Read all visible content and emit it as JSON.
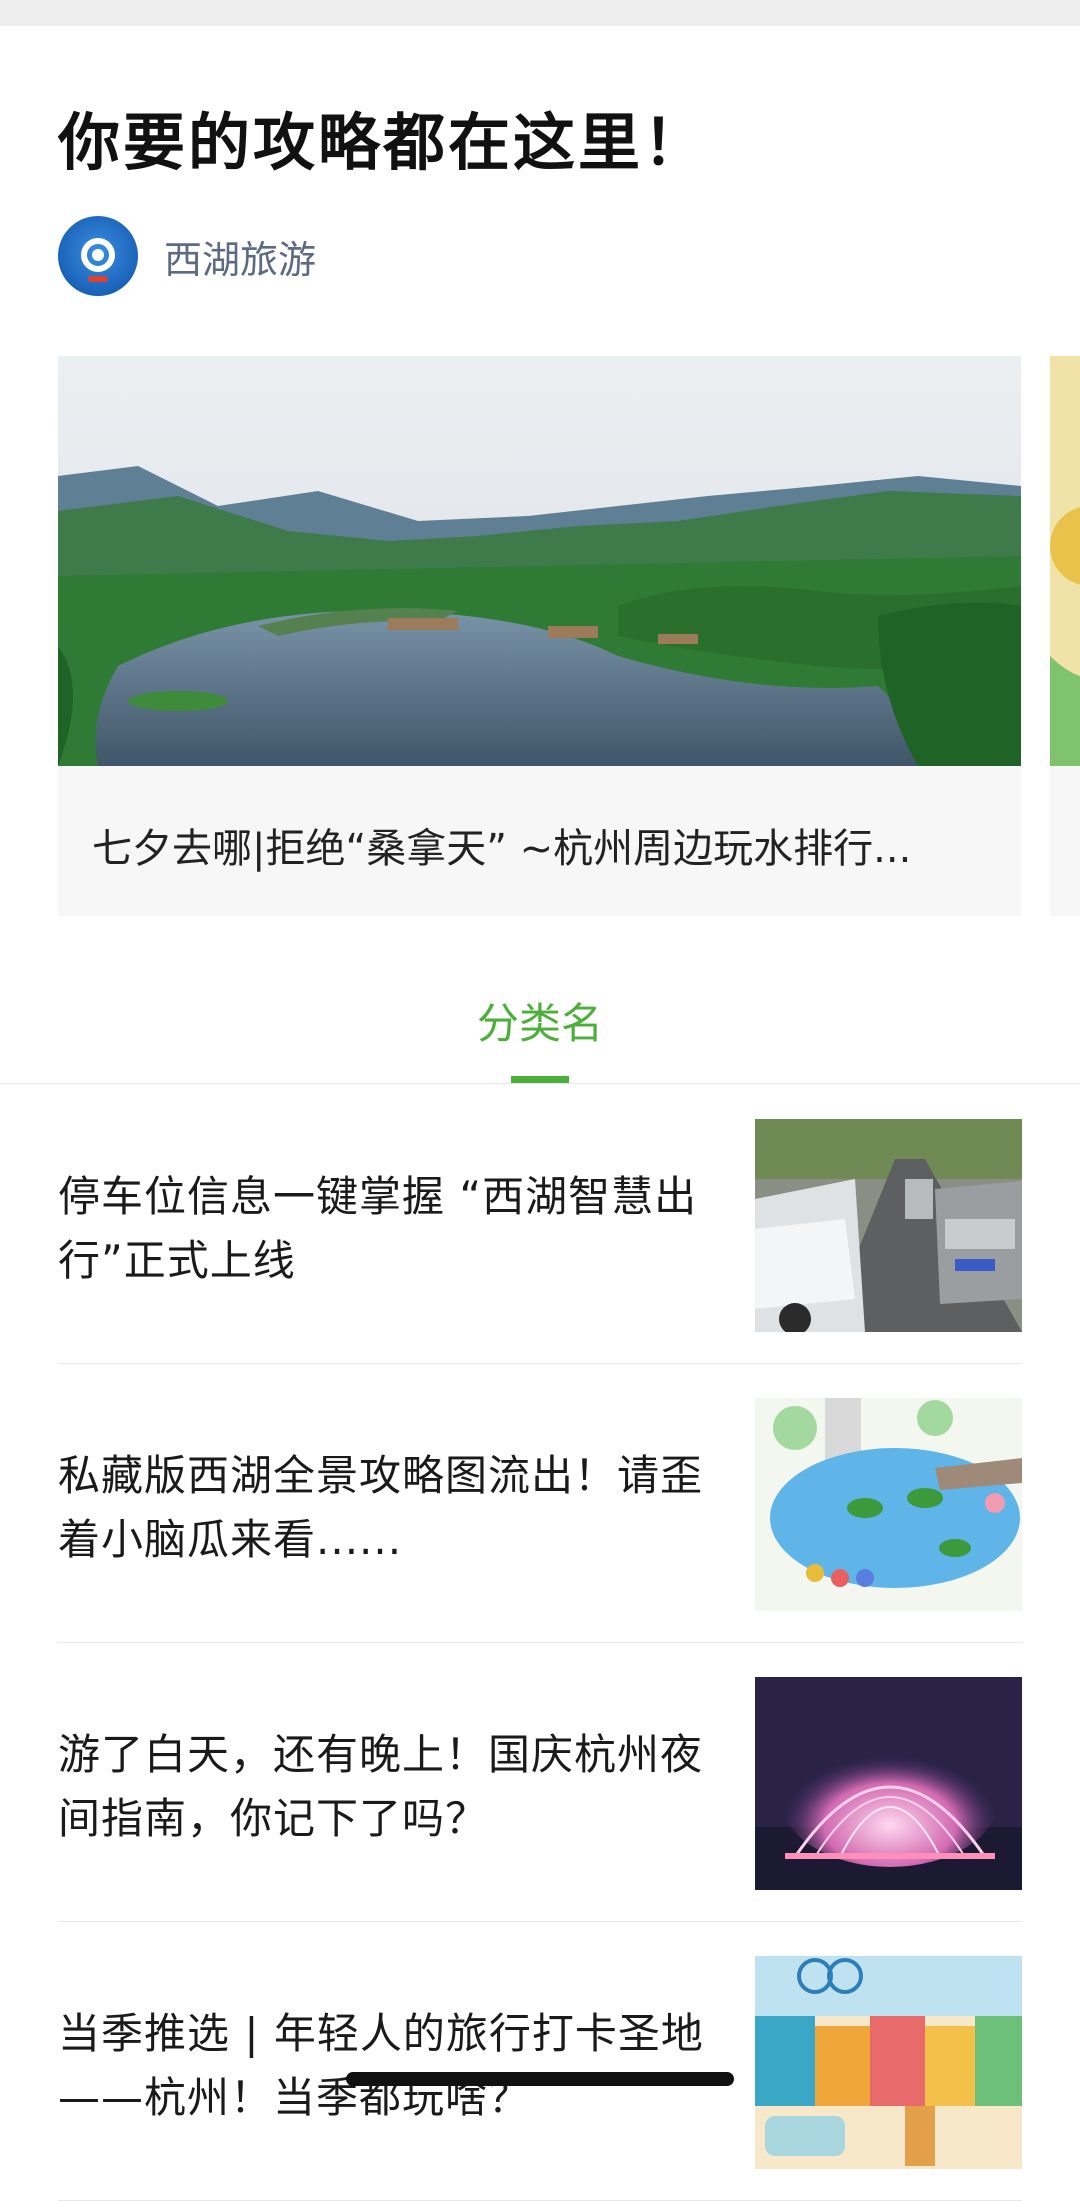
{
  "page": {
    "title": "你要的攻略都在这里！"
  },
  "account": {
    "name": "西湖旅游",
    "avatar_icon": "xihu-logo-icon"
  },
  "carousel": {
    "cards": [
      {
        "title": "七夕去哪|拒绝“桑拿天” ~杭州周边玩水排行..."
      }
    ]
  },
  "tabs": {
    "active_label": "分类名",
    "accent_color": "#4caf3a"
  },
  "articles": [
    {
      "title": "停车位信息一键掌握 “西湖智慧出行”正式上线"
    },
    {
      "title": "私藏版西湖全景攻略图流出！请歪着小脑瓜来看......"
    },
    {
      "title": "游了白天，还有晚上！国庆杭州夜间指南，你记下了吗？"
    },
    {
      "title": "当季推选 | 年轻人的旅行打卡圣地——杭州！当季都玩啥？"
    }
  ]
}
